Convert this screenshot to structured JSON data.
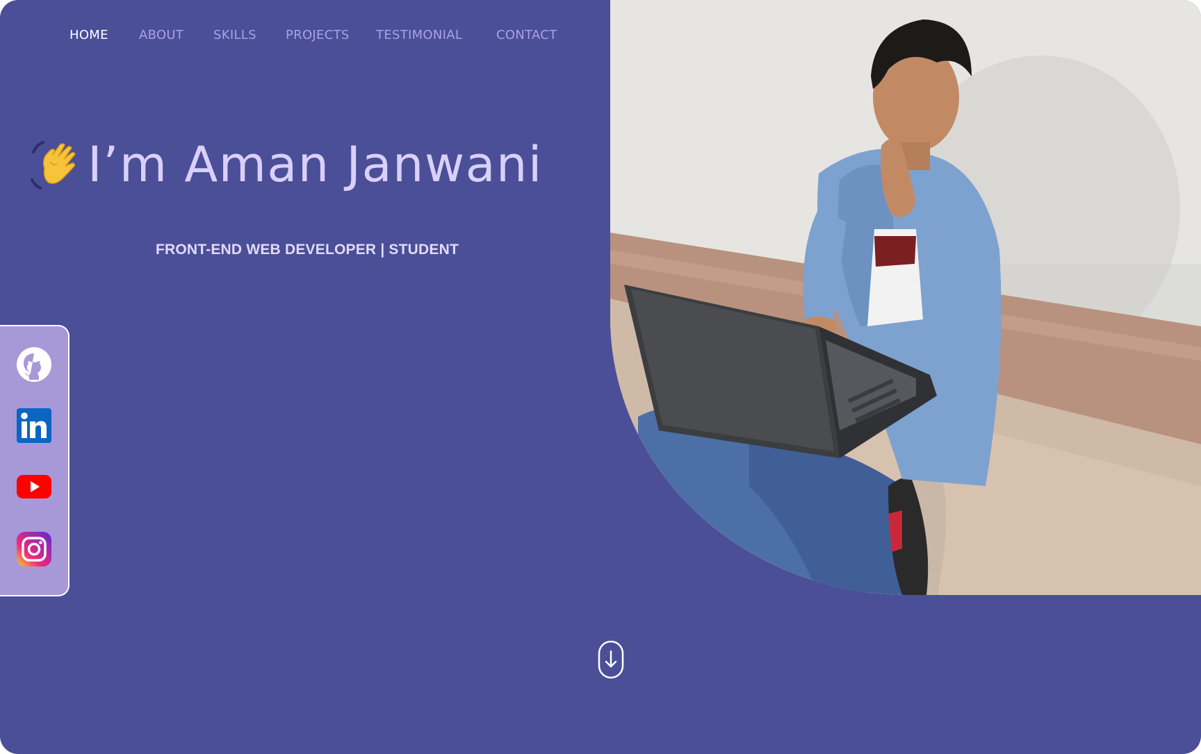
{
  "nav": {
    "items": [
      {
        "label": "HOME",
        "active": true
      },
      {
        "label": "ABOUT",
        "active": false
      },
      {
        "label": "SKILLS",
        "active": false
      },
      {
        "label": "PROJECTS",
        "active": false
      },
      {
        "label": "TESTIMONIAL",
        "active": false
      },
      {
        "label": "CONTACT",
        "active": false
      }
    ]
  },
  "hero": {
    "wave_icon": "waving-hand-icon",
    "name": "I’m Aman Janwani",
    "subtitle": "FRONT-END WEB DEVELOPER | STUDENT"
  },
  "photo": {
    "icon": "profile-photo"
  },
  "social": {
    "links": [
      {
        "name": "GitHub",
        "icon": "github-icon"
      },
      {
        "name": "LinkedIn",
        "icon": "linkedin-icon"
      },
      {
        "name": "YouTube",
        "icon": "youtube-icon"
      },
      {
        "name": "Instagram",
        "icon": "instagram-icon"
      }
    ]
  },
  "scroll": {
    "icon": "scroll-down-icon"
  },
  "colors": {
    "background": "#4a4f97",
    "nav_text": "#a9a2e6",
    "nav_active": "#ffffff",
    "heading": "#d9d0fb",
    "social_bar": "#a798d8"
  }
}
